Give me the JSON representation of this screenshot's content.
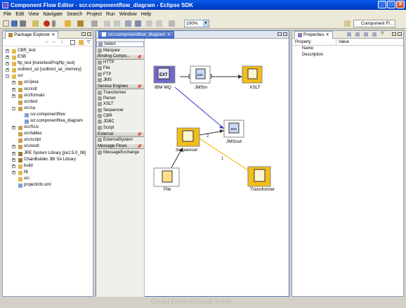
{
  "window": {
    "title": "Component Flow Editor - scr.componentflow_diagram - Eclipse SDK",
    "buttons": [
      "_",
      "□",
      "X"
    ]
  },
  "menu": [
    "File",
    "Edit",
    "View",
    "Navigate",
    "Search",
    "Project",
    "Run",
    "Window",
    "Help"
  ],
  "toolbar": {
    "zoom": "100%",
    "perspective": "Component Fl..."
  },
  "package_explorer": {
    "title": "Package Explorer",
    "items": [
      {
        "label": "CBR_test",
        "level": 0,
        "exp": "+",
        "icon": "folder"
      },
      {
        "label": "ESB",
        "level": 0,
        "exp": "+",
        "icon": "folder"
      },
      {
        "label": "ftp_test [trunk/testProj/ftp_test]",
        "level": 0,
        "exp": "+",
        "icon": "folder"
      },
      {
        "label": "scdirect_az [scdirect_az_memory]",
        "level": 0,
        "exp": "+",
        "icon": "folder"
      },
      {
        "label": "scr",
        "level": 0,
        "exp": "-",
        "icon": "folder"
      },
      {
        "label": "src/java",
        "level": 1,
        "exp": "+",
        "icon": "pkg"
      },
      {
        "label": "src/xslt",
        "level": 1,
        "exp": "+",
        "icon": "pkg"
      },
      {
        "label": "src/formats",
        "level": 1,
        "exp": "+",
        "icon": "pkg"
      },
      {
        "label": "src/test",
        "level": 1,
        "exp": "",
        "icon": "pkg"
      },
      {
        "label": "src/sa",
        "level": 1,
        "exp": "-",
        "icon": "pkg"
      },
      {
        "label": "scr.componentflow",
        "level": 2,
        "exp": "",
        "icon": "file"
      },
      {
        "label": "scr.componentflow_diagram",
        "level": 2,
        "exp": "",
        "icon": "file"
      },
      {
        "label": "src/SUs",
        "level": 1,
        "exp": "+",
        "icon": "pkg"
      },
      {
        "label": "src/tables",
        "level": 1,
        "exp": "",
        "icon": "pkg"
      },
      {
        "label": "src/script",
        "level": 1,
        "exp": "",
        "icon": "pkg"
      },
      {
        "label": "src/wsdl",
        "level": 1,
        "exp": "+",
        "icon": "pkg"
      },
      {
        "label": "JRE System Library [jre1.5.0_08]",
        "level": 1,
        "exp": "+",
        "icon": "lib"
      },
      {
        "label": "ChainBuilder JBI SA Library",
        "level": 1,
        "exp": "+",
        "icon": "lib"
      },
      {
        "label": "build",
        "level": 1,
        "exp": "+",
        "icon": "folder"
      },
      {
        "label": "lib",
        "level": 1,
        "exp": "+",
        "icon": "folder"
      },
      {
        "label": "src",
        "level": 1,
        "exp": "",
        "icon": "folder"
      },
      {
        "label": "projectinfo.xml",
        "level": 1,
        "exp": "",
        "icon": "file"
      }
    ]
  },
  "editor": {
    "tab": "scr.componentflow_diagram"
  },
  "palette": {
    "items": [
      {
        "type": "item",
        "label": "Select",
        "selected": true
      },
      {
        "type": "item",
        "label": "Marquee"
      },
      {
        "type": "drawer",
        "label": "Binding Compo..."
      },
      {
        "type": "item",
        "label": "HTTP"
      },
      {
        "type": "item",
        "label": "File"
      },
      {
        "type": "item",
        "label": "FTP"
      },
      {
        "type": "item",
        "label": "JMS"
      },
      {
        "type": "drawer",
        "label": "Service Engines"
      },
      {
        "type": "item",
        "label": "Transformer"
      },
      {
        "type": "item",
        "label": "Parser"
      },
      {
        "type": "item",
        "label": "XSLT"
      },
      {
        "type": "item",
        "label": "Sequencer"
      },
      {
        "type": "item",
        "label": "CBR"
      },
      {
        "type": "item",
        "label": "JDBC"
      },
      {
        "type": "item",
        "label": "Script"
      },
      {
        "type": "drawer",
        "label": "External"
      },
      {
        "type": "item",
        "label": "ExternalSystem"
      },
      {
        "type": "drawer",
        "label": "Message Flows"
      },
      {
        "type": "item",
        "label": "MessageExchange"
      }
    ]
  },
  "diagram": {
    "nodes": [
      {
        "label": "IBM MQ",
        "icon_text": "EXT",
        "color": "#6f67c9"
      },
      {
        "label": "JMSin",
        "icon_text": "JMS",
        "color": "#ffffff"
      },
      {
        "label": "XSLT",
        "icon_text": "",
        "color": "#f3bd17"
      },
      {
        "label": "Sequencer",
        "icon_text": "",
        "color": "#f3bd17"
      },
      {
        "label": "JMSout",
        "icon_text": "JMS",
        "color": "#ffffff"
      },
      {
        "label": "File",
        "icon_text": "",
        "color": "#ffffff"
      },
      {
        "label": "Transformer",
        "icon_text": "",
        "color": "#f3bd17"
      }
    ],
    "edge_labels": [
      "2",
      "1"
    ]
  },
  "properties": {
    "title": "Properties",
    "col_property": "Property",
    "col_value": "Value",
    "rows": [
      "Name",
      "Description"
    ]
  },
  "watermark": "GearDownload.com"
}
